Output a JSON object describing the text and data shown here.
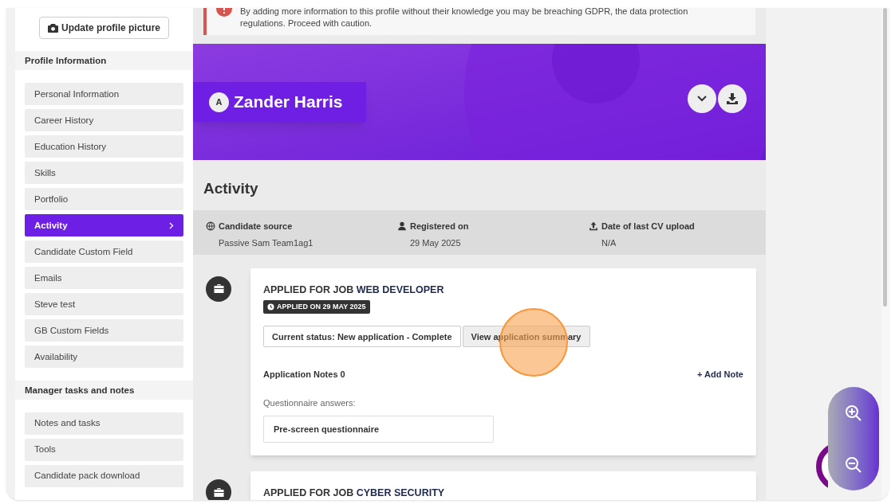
{
  "sidebar": {
    "update_picture_button": "Update profile picture",
    "sections": [
      {
        "title": "Profile Information",
        "items": [
          {
            "label": "Personal Information",
            "selected": false
          },
          {
            "label": "Career History",
            "selected": false
          },
          {
            "label": "Education History",
            "selected": false
          },
          {
            "label": "Skills",
            "selected": false
          },
          {
            "label": "Portfolio",
            "selected": false
          },
          {
            "label": "Activity",
            "selected": true
          },
          {
            "label": "Candidate Custom Field",
            "selected": false
          },
          {
            "label": "Emails",
            "selected": false
          },
          {
            "label": "Steve test",
            "selected": false
          },
          {
            "label": "GB Custom Fields",
            "selected": false
          },
          {
            "label": "Availability",
            "selected": false
          }
        ]
      },
      {
        "title": "Manager tasks and notes",
        "items": [
          {
            "label": "Notes and tasks",
            "selected": false
          },
          {
            "label": "Tools",
            "selected": false
          },
          {
            "label": "Candidate pack download",
            "selected": false
          }
        ]
      }
    ]
  },
  "warning": {
    "text": "By adding more information to this profile without their knowledge you may be breaching GDPR, the data protection regulations. Proceed with caution."
  },
  "profile": {
    "avatar": "A",
    "name": "Zander Harris"
  },
  "activity": {
    "title": "Activity",
    "info": [
      {
        "kind": "globe",
        "label": "Candidate source",
        "value": "Passive Sam Team1ag1"
      },
      {
        "kind": "person",
        "label": "Registered on",
        "value": "29 May 2025"
      },
      {
        "kind": "upload",
        "label": "Date of last CV upload",
        "value": "N/A"
      }
    ],
    "entries": [
      {
        "prefix": "APPLIED FOR JOB",
        "job": "WEB DEVELOPER",
        "applied": "APPLIED ON 29 MAY 2025",
        "status": "Current status: New application - Complete",
        "summary_button": "View application summary",
        "notes_label": "Application Notes 0",
        "add_note": "+ Add Note",
        "questionnaire_label": "Questionnaire answers:",
        "questionnaire": "Pre-screen questionnaire"
      },
      {
        "prefix": "APPLIED FOR JOB",
        "job": "CYBER SECURITY"
      }
    ]
  }
}
